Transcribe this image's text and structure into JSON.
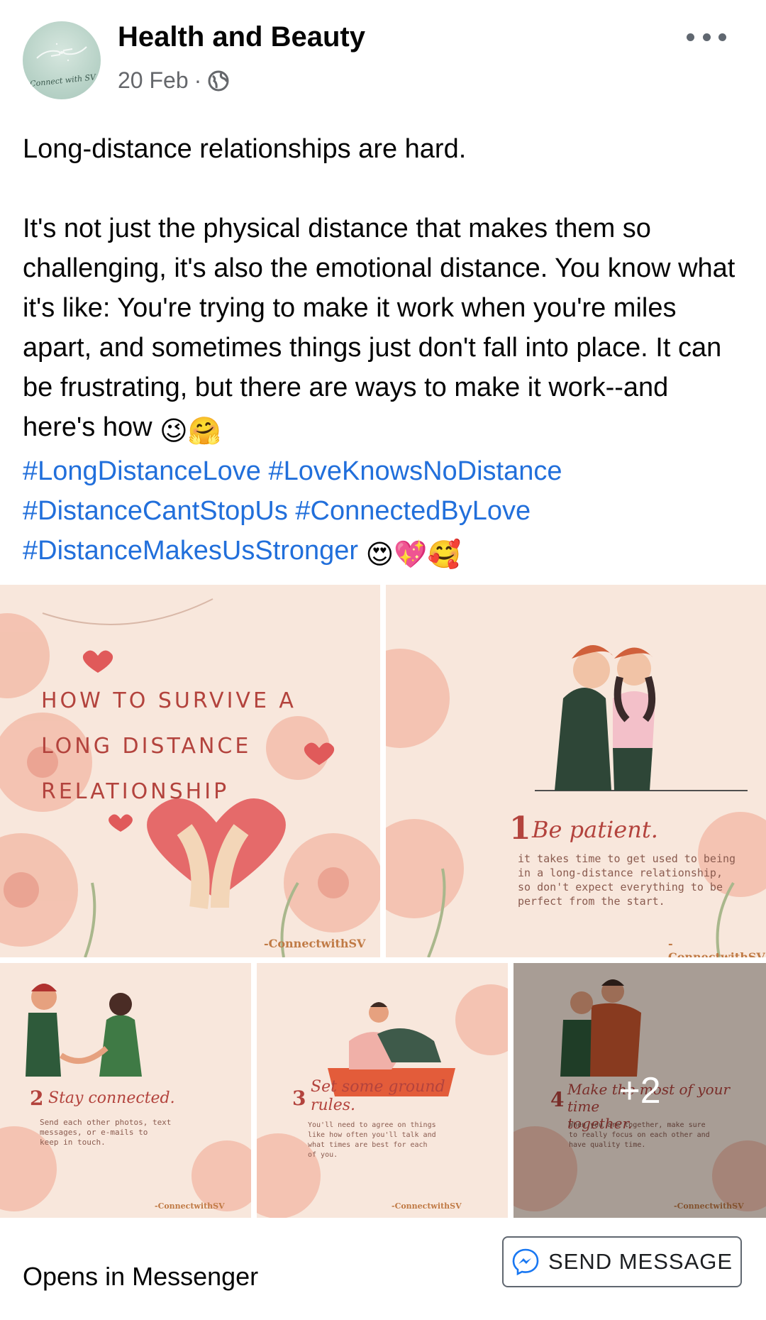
{
  "post": {
    "page_name": "Health and Beauty",
    "date": "20 Feb",
    "separator": "·",
    "avatar_text": "Connect with SV",
    "paragraph1": "Long-distance relationships are hard.",
    "paragraph2": "It's not just the physical distance that makes them so challenging, it's also the emotional distance. You know what it's like: You're trying to make it work when you're miles apart, and sometimes things just don't fall into place. It can be frustrating, but there are ways to make it work--and here's how",
    "paragraph2_emoji": "😉🤗",
    "hashtags_line1": "#LongDistanceLove #LoveKnowsNoDistance",
    "hashtags_line2": "#DistanceCantStopUs #ConnectedByLove",
    "hashtags_line3": "#DistanceMakesUsStronger",
    "hashtags_emoji": "😍💖🥰"
  },
  "media": {
    "tile1": {
      "line1": "HOW TO SURVIVE A",
      "line2": "LONG DISTANCE",
      "line3": "RELATIONSHIP",
      "credit": "-ConnectwithSV"
    },
    "tile2": {
      "number": "1",
      "heading": "Be patient.",
      "body1": "it takes time to get used to being",
      "body2": "in a long-distance relationship,",
      "body3": "so don't expect everything to be",
      "body4": "perfect from the start.",
      "credit": "-ConnectwithSV"
    },
    "tile3": {
      "number": "2",
      "heading": "Stay connected.",
      "body1": "Send each other photos, text",
      "body2": "messages, or e-mails to",
      "body3": "keep in touch.",
      "credit": "-ConnectwithSV"
    },
    "tile4": {
      "number": "3",
      "heading1": "Set some ground",
      "heading2": "rules.",
      "body1": "You'll need to agree on things",
      "body2": "like how often you'll talk and",
      "body3": "what times are best for each",
      "body4": "of you.",
      "credit": "-ConnectwithSV"
    },
    "tile5": {
      "number": "4",
      "heading1": "Make the most of your time",
      "heading2": "together.",
      "body1": "When you are together, make sure",
      "body2": "to really focus on each other and",
      "body3": "have quality time.",
      "credit": "-ConnectwithSV",
      "more_count": "+2"
    }
  },
  "footer": {
    "label": "Opens in Messenger",
    "button": "SEND MESSAGE"
  },
  "colors": {
    "hashtag": "#216fdb",
    "accent_red": "#b3433d",
    "tile_bg": "#f7e6db"
  },
  "icons": [
    "globe-icon",
    "more-options-icon",
    "messenger-icon"
  ]
}
